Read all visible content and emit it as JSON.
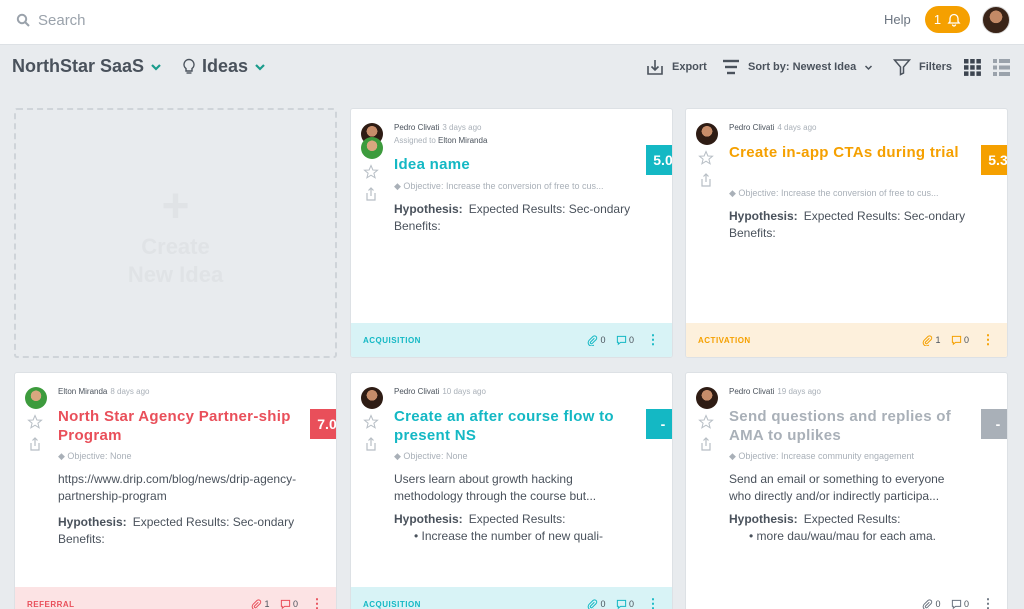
{
  "topbar": {
    "search_placeholder": "Search",
    "help_label": "Help",
    "notification_count": "1"
  },
  "subbar": {
    "workspace_name": "NorthStar SaaS",
    "section_name": "Ideas",
    "export_label": "Export",
    "sort_label": "Sort by: Newest Idea",
    "filters_label": "Filters"
  },
  "create_card": {
    "label_line1": "Create",
    "label_line2": "New Idea"
  },
  "colors": {
    "teal": "#14b8c4",
    "orange": "#f5a000",
    "red": "#e94f5a",
    "gray": "#a9b0b8"
  },
  "cards": [
    {
      "author": "Pedro Clivati",
      "ago": "3 days ago",
      "assigned_prefix": "Assigned to",
      "assignee": "Elton Miranda",
      "title": "Idea name",
      "objective": "Objective: Increase the conversion of free to cus...",
      "desc": "",
      "hypothesis_label": "Hypothesis:",
      "hypothesis_text": "Expected Results: Sec-ondary Benefits:",
      "bullet": "",
      "score": "5.0",
      "tag": "ACQUISITION",
      "attachments": "0",
      "comments": "0"
    },
    {
      "author": "Pedro Clivati",
      "ago": "4 days ago",
      "title": "Create in-app CTAs during trial",
      "objective": "Objective: Increase the conversion of free to cus...",
      "hypothesis_label": "Hypothesis:",
      "hypothesis_text": "Expected Results: Sec-ondary Benefits:",
      "score": "5.3",
      "tag": "ACTIVATION",
      "attachments": "1",
      "comments": "0"
    },
    {
      "author": "Elton Miranda",
      "ago": "8 days ago",
      "title": "North Star Agency Partner-ship Program",
      "objective": "Objective: None",
      "desc": "https://www.drip.com/blog/news/drip-agency-partnership-program",
      "hypothesis_label": "Hypothesis:",
      "hypothesis_text": "Expected Results: Sec-ondary Benefits:",
      "score": "7.0",
      "tag": "REFERRAL",
      "attachments": "1",
      "comments": "0"
    },
    {
      "author": "Pedro Clivati",
      "ago": "10 days ago",
      "title": "Create an after course flow to present NS",
      "objective": "Objective: None",
      "desc": "Users learn about growth hacking methodology through the course but...",
      "hypothesis_label": "Hypothesis:",
      "hypothesis_text": "Expected Results:",
      "bullet": "Increase the number of new quali-",
      "score": "-",
      "tag": "ACQUISITION",
      "attachments": "0",
      "comments": "0"
    },
    {
      "author": "Pedro Clivati",
      "ago": "19 days ago",
      "title": "Send questions and replies of AMA to uplikes",
      "objective": "Objective: Increase community engagement",
      "desc": "Send an email or something to everyone who directly and/or indirectly participa...",
      "hypothesis_label": "Hypothesis:",
      "hypothesis_text": "Expected Results:",
      "bullet": "more dau/wau/mau for each ama.",
      "score": "-",
      "tag": "",
      "attachments": "0",
      "comments": "0"
    }
  ]
}
